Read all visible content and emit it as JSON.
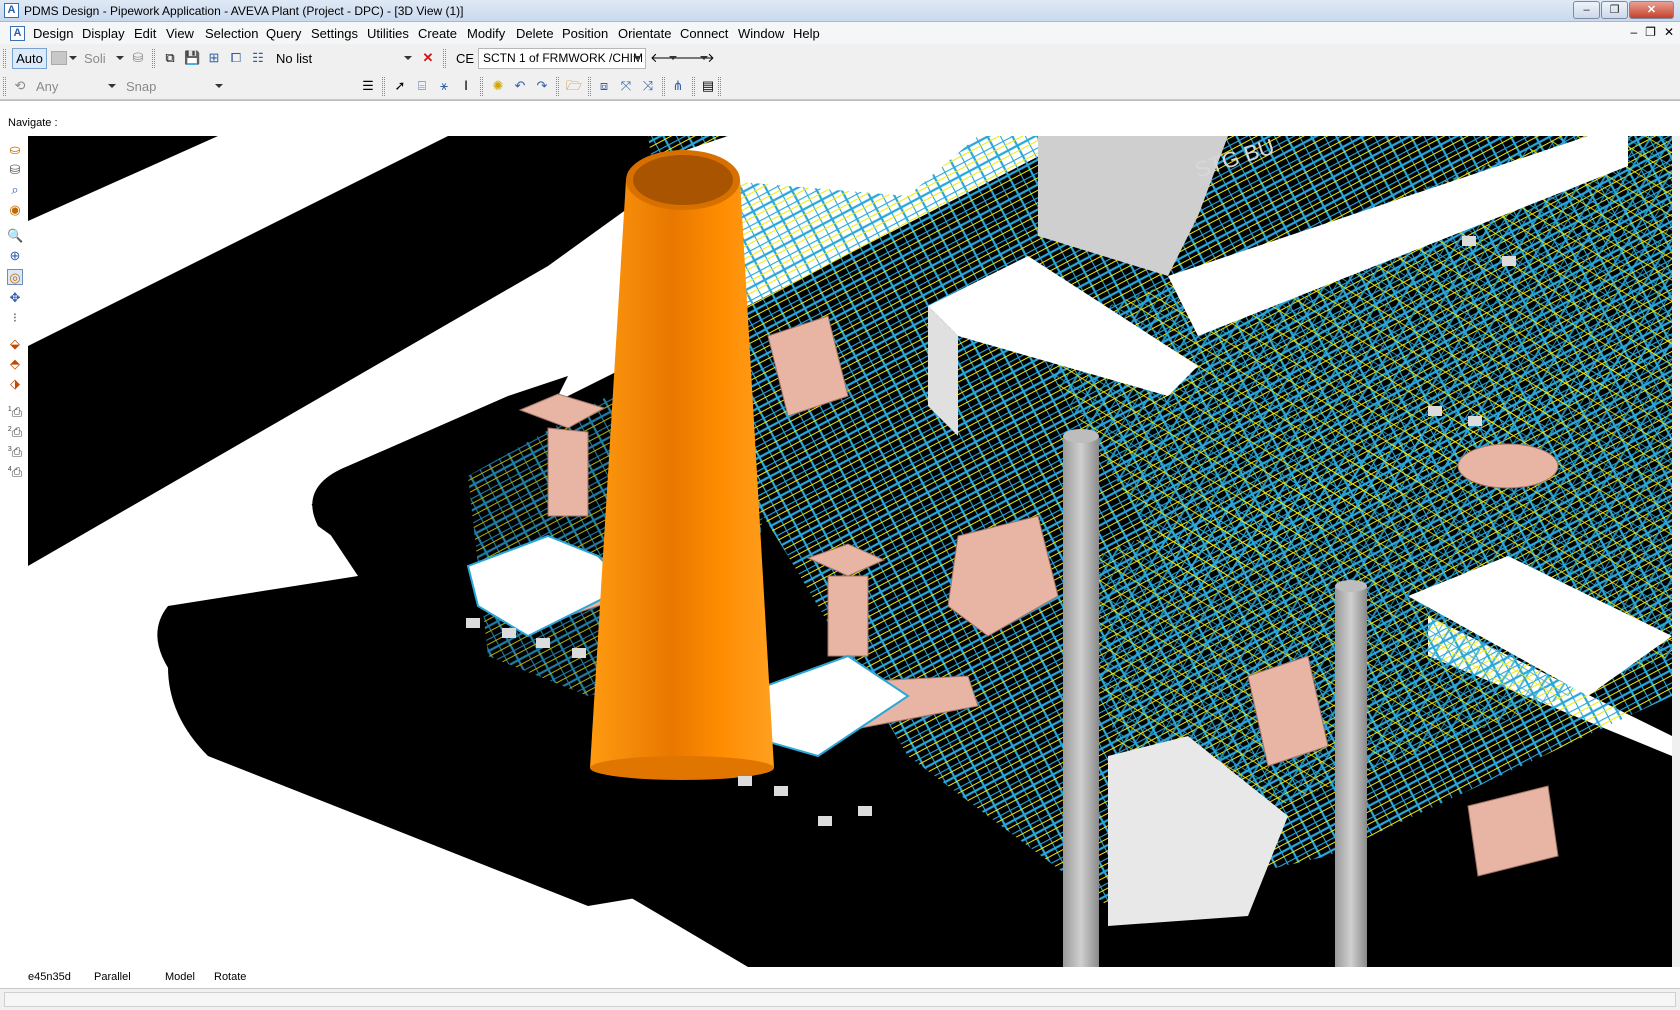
{
  "window": {
    "title": "PDMS Design - Pipework Application -  AVEVA Plant (Project - DPC) - [3D View (1)]",
    "controls": [
      "–",
      "❐",
      "✕"
    ]
  },
  "menubar": {
    "items": [
      "Design",
      "Display",
      "Edit",
      "View",
      "Selection",
      "Query",
      "Settings",
      "Utilities",
      "Create",
      "Modify",
      "Delete",
      "Position",
      "Orientate",
      "Connect",
      "Window",
      "Help"
    ],
    "mdi_controls": [
      "–",
      "❐",
      "✕"
    ]
  },
  "toolbar1": {
    "auto_label": "Auto",
    "fill_label": "Soli",
    "list_label": "No list",
    "ce_label": "CE",
    "ce_value": "SCTN 1 of FRMWORK /CHIM"
  },
  "toolbar2": {
    "pick_label": "Any",
    "snap_label": "Snap"
  },
  "navigate_label": "Navigate :",
  "left_tools": [
    "camera-1-icon",
    "camera-2-icon",
    "camera-3-icon",
    "camera-4-icon"
  ],
  "left_tool_digits": [
    "1",
    "2",
    "3",
    "4"
  ],
  "status": {
    "direction": "e45n35d",
    "projection": "Parallel",
    "mode": "Model",
    "action": "Rotate"
  },
  "colors": {
    "chimney": "#ff8a00",
    "steel": "#2aa7d8",
    "pipe": "#f5e900",
    "duct": "#e8b4a4",
    "background": "#000000",
    "slab": "#ffffff"
  }
}
